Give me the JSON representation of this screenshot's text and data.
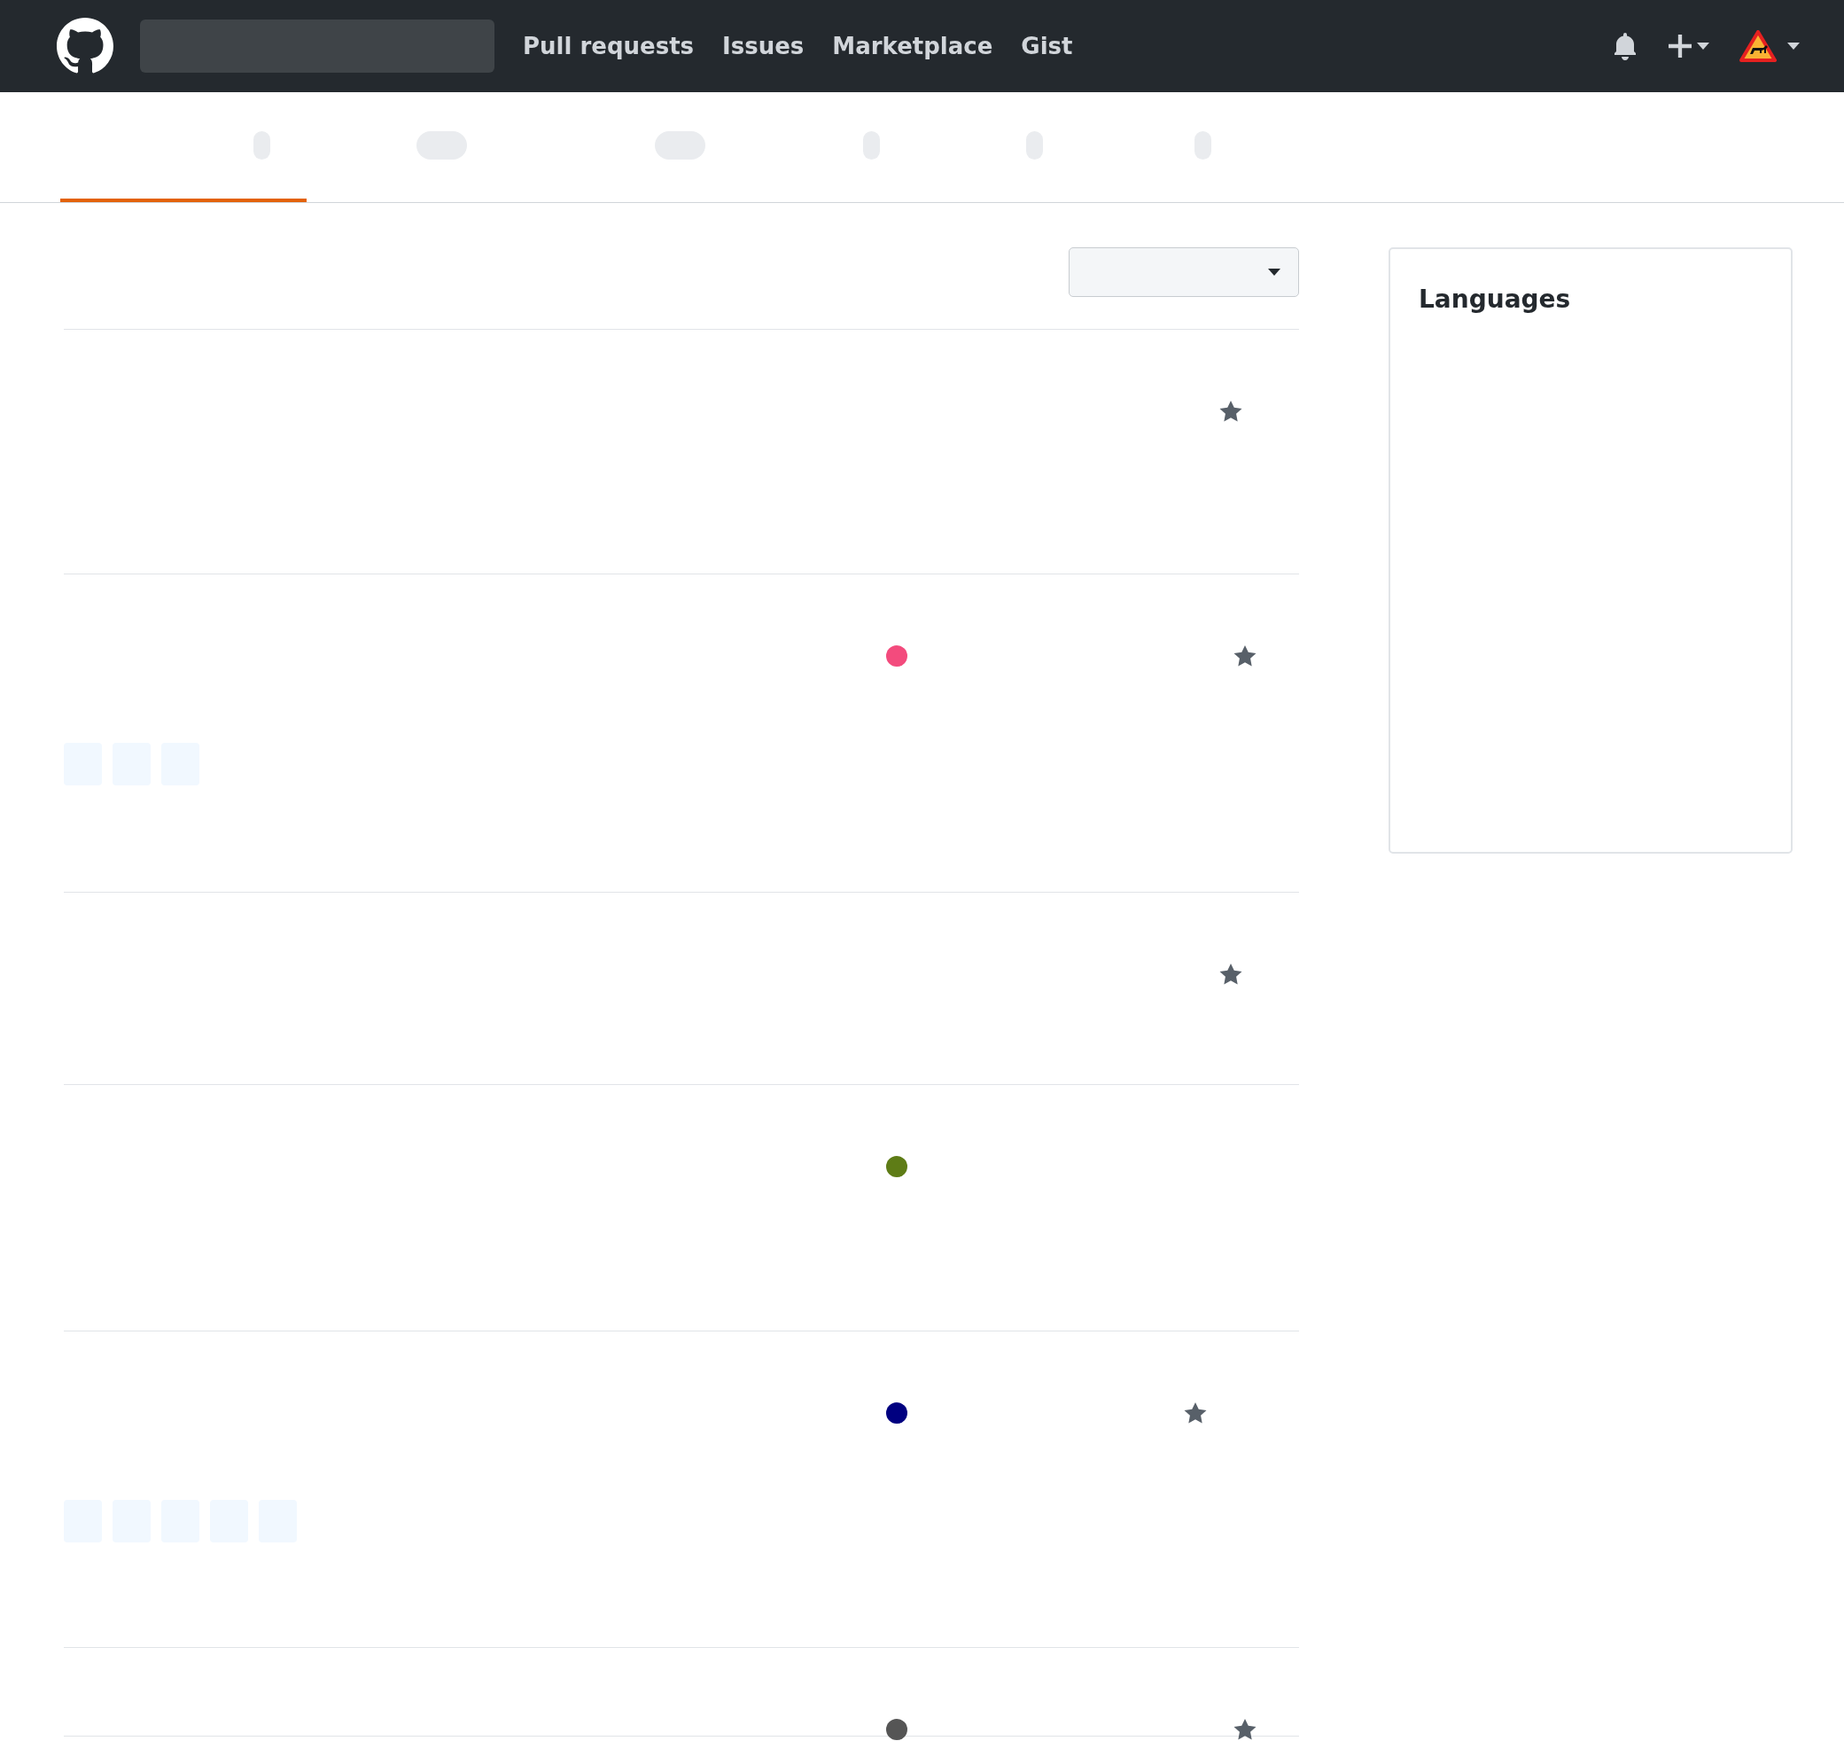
{
  "header": {
    "nav": [
      "Pull requests",
      "Issues",
      "Marketplace",
      "Gist"
    ]
  },
  "tabs": [
    {
      "selected": true,
      "kind": "narrow"
    },
    {
      "selected": false,
      "kind": "wide"
    },
    {
      "selected": false,
      "kind": "wide"
    },
    {
      "selected": false,
      "kind": "narrow"
    },
    {
      "selected": false,
      "kind": "narrow"
    },
    {
      "selected": false,
      "kind": "narrow"
    }
  ],
  "sidebar": {
    "title": "Languages"
  },
  "repos": [
    {
      "star": true
    },
    {
      "color": "#f34b7d",
      "star": true,
      "topics": [
        {
          "kind": "blank"
        },
        {
          "kind": "blank"
        },
        {
          "kind": "blank"
        }
      ]
    },
    {
      "star": true
    },
    {
      "color": "#5e7c16",
      "star": false
    },
    {
      "color": "#000080",
      "star": true,
      "topics": [
        {
          "kind": "blank"
        },
        {
          "kind": "blank"
        },
        {
          "kind": "blank"
        },
        {
          "kind": "blank"
        },
        {
          "kind": "blank"
        }
      ]
    },
    {
      "color": "#555555",
      "star": true
    }
  ]
}
